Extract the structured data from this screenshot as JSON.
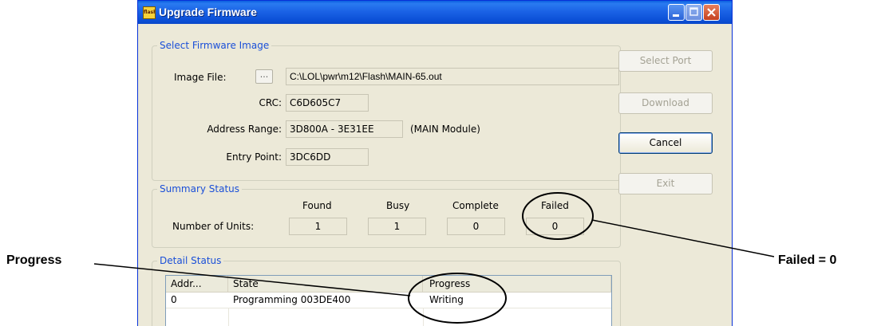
{
  "window": {
    "title": "Upgrade Firmware",
    "icon_text": "flash"
  },
  "image_group": {
    "legend": "Select Firmware Image",
    "image_file_label": "Image File:",
    "browse_label": "...",
    "image_file_value": "C:\\LOL\\pwr\\m12\\Flash\\MAIN-65.out",
    "crc_label": "CRC:",
    "crc_value": "C6D605C7",
    "address_label": "Address Range:",
    "address_value": "3D800A - 3E31EE",
    "module_note": "(MAIN Module)",
    "entry_label": "Entry Point:",
    "entry_value": "3DC6DD"
  },
  "summary": {
    "legend": "Summary Status",
    "row_label": "Number of Units:",
    "columns": [
      "Found",
      "Busy",
      "Complete",
      "Failed"
    ],
    "values": [
      "1",
      "1",
      "0",
      "0"
    ]
  },
  "detail": {
    "legend": "Detail Status",
    "columns": [
      "Addr...",
      "State",
      "Progress"
    ],
    "rows": [
      {
        "addr": "0",
        "state": "Programming 003DE400",
        "progress": "Writing"
      }
    ]
  },
  "side_buttons": {
    "select_port": "Select Port",
    "download": "Download",
    "cancel": "Cancel",
    "exit": "Exit"
  },
  "annotations": {
    "progress_label": "Progress",
    "failed_label": "Failed = 0"
  }
}
